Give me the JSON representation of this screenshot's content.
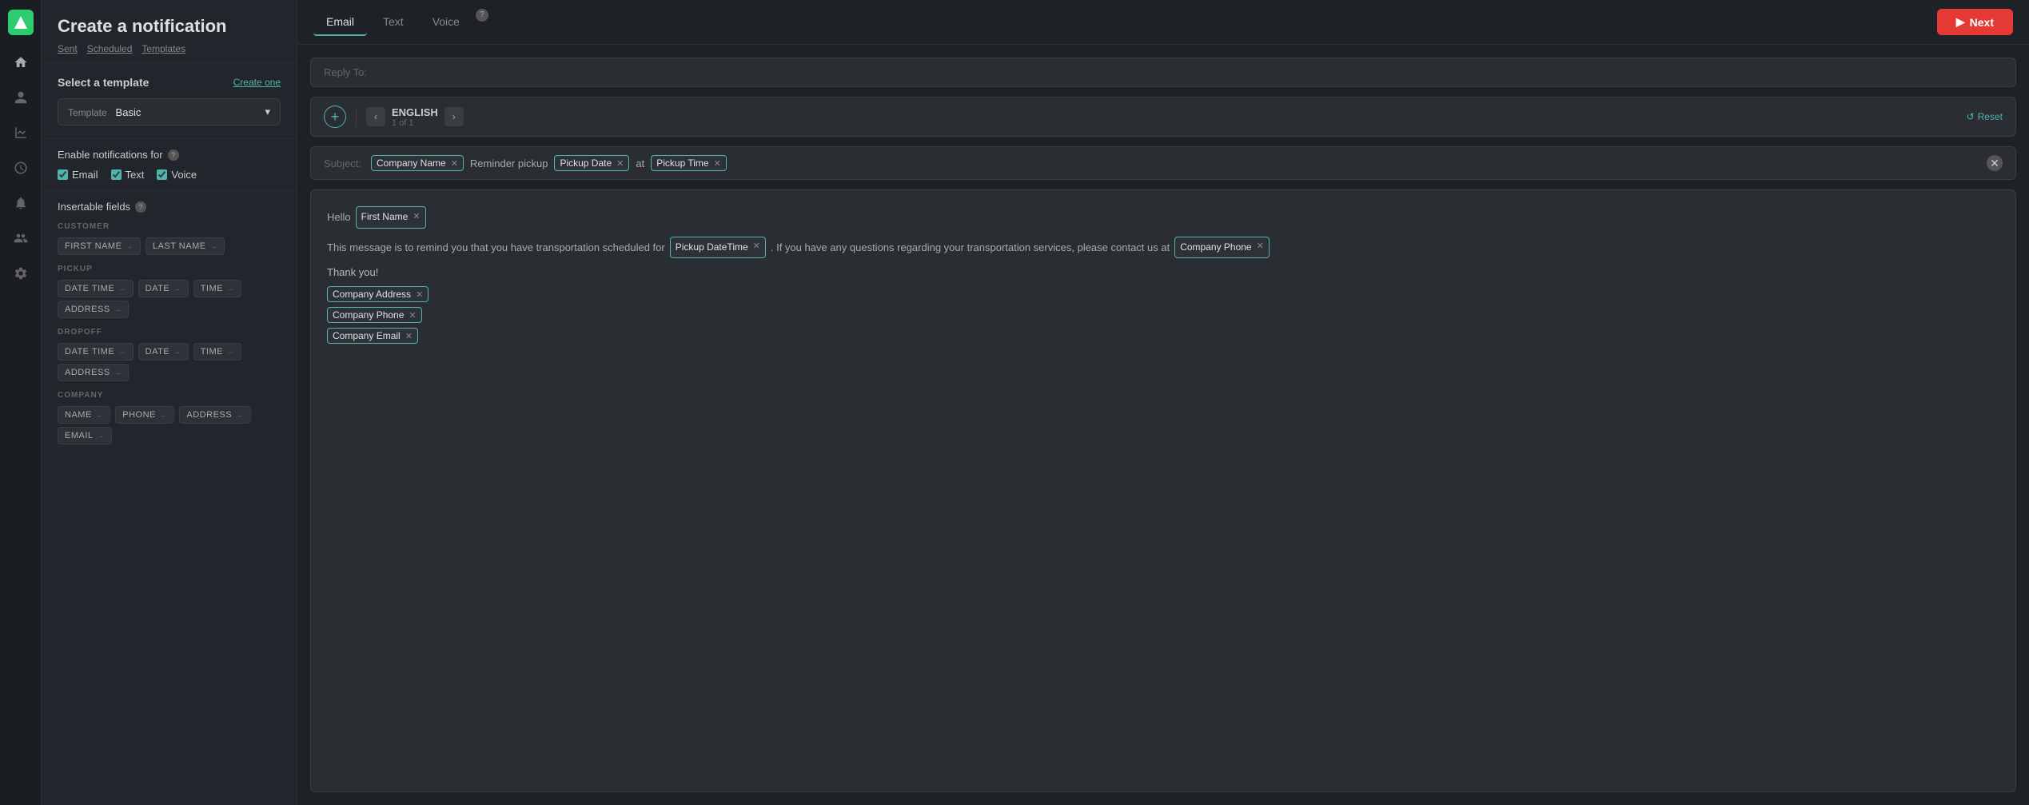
{
  "app": {
    "title": "Create a notification"
  },
  "topnav": {
    "links": [
      "Sent",
      "Scheduled",
      "Templates"
    ]
  },
  "tabs": {
    "items": [
      "Email",
      "Text",
      "Voice"
    ],
    "active": "Email"
  },
  "next_button": "Next",
  "sidebar": {
    "template_section_title": "Select a template",
    "create_link": "Create one",
    "template_label": "Template",
    "template_value": "Basic",
    "enable_title": "Enable notifications for",
    "checkboxes": [
      {
        "label": "Email",
        "checked": true
      },
      {
        "label": "Text",
        "checked": true
      },
      {
        "label": "Voice",
        "checked": true
      }
    ],
    "fields_title": "Insertable fields",
    "field_groups": [
      {
        "group": "CUSTOMER",
        "chips": [
          "FIRST NAME",
          "LAST NAME"
        ]
      },
      {
        "group": "PICKUP",
        "chips": [
          "DATE TIME",
          "DATE",
          "TIME",
          "ADDRESS"
        ]
      },
      {
        "group": "DROPOFF",
        "chips": [
          "DATE TIME",
          "DATE",
          "TIME",
          "ADDRESS"
        ]
      },
      {
        "group": "COMPANY",
        "chips": [
          "NAME",
          "PHONE",
          "ADDRESS",
          "EMAIL"
        ]
      }
    ]
  },
  "editor": {
    "reply_to_placeholder": "Reply To:",
    "language": "ENGLISH",
    "language_sub": "1 of 1",
    "reset_label": "Reset",
    "subject_label": "Subject:",
    "subject_tags": [
      "Company Name",
      "Reminder pickup",
      "Pickup Date",
      "at",
      "Pickup Time"
    ],
    "body_hello": "Hello",
    "first_name_tag": "First Name",
    "body_line1_before": "This message is to remind you that you have transportation scheduled for",
    "pickup_datetime_tag": "Pickup DateTime",
    "body_line1_after": ". If you have any questions regarding your transportation services, please contact us at",
    "company_phone_inline_tag": "Company Phone",
    "body_thank_you": "Thank you!",
    "company_tags": [
      "Company Address",
      "Company Phone",
      "Company Email"
    ]
  },
  "icons": {
    "home": "⌂",
    "person": "👤",
    "chart": "📊",
    "clock": "🕐",
    "people": "👥",
    "settings": "⚙",
    "bell": "🔔",
    "add": "+",
    "arrow_left": "‹",
    "arrow_right": "›",
    "arrow_right_small": "→",
    "chevron_down": "▾",
    "reset": "↺",
    "check": "✓",
    "info": "?"
  }
}
